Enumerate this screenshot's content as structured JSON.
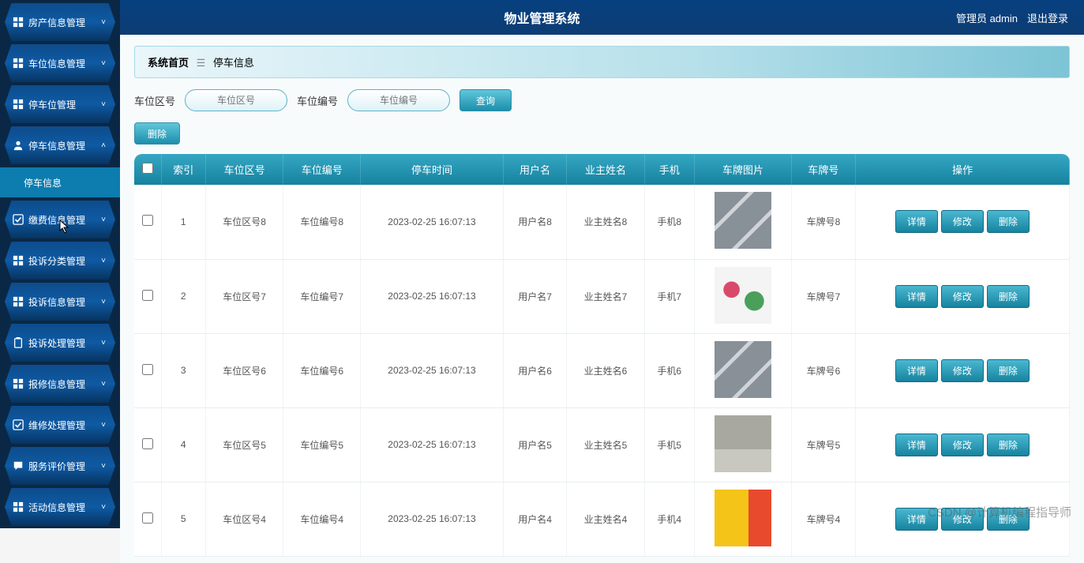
{
  "header": {
    "title": "物业管理系统",
    "admin_label": "管理员 admin",
    "logout": "退出登录"
  },
  "sidebar": {
    "items": [
      {
        "label": "房产信息管理",
        "icon": "grid-icon",
        "expanded": false
      },
      {
        "label": "车位信息管理",
        "icon": "grid-icon",
        "expanded": false
      },
      {
        "label": "停车位管理",
        "icon": "grid-icon",
        "expanded": false
      },
      {
        "label": "停车信息管理",
        "icon": "user-icon",
        "expanded": true,
        "children": [
          {
            "label": "停车信息",
            "active": true
          }
        ]
      },
      {
        "label": "缴费信息管理",
        "icon": "check-icon",
        "expanded": false,
        "hover": true
      },
      {
        "label": "投诉分类管理",
        "icon": "grid-icon",
        "expanded": false
      },
      {
        "label": "投诉信息管理",
        "icon": "grid-icon",
        "expanded": false
      },
      {
        "label": "投诉处理管理",
        "icon": "clipboard-icon",
        "expanded": false
      },
      {
        "label": "报修信息管理",
        "icon": "grid-icon",
        "expanded": false
      },
      {
        "label": "维修处理管理",
        "icon": "check-icon",
        "expanded": false
      },
      {
        "label": "服务评价管理",
        "icon": "chat-icon",
        "expanded": false
      },
      {
        "label": "活动信息管理",
        "icon": "grid-icon",
        "expanded": false
      }
    ]
  },
  "breadcrumb": {
    "home": "系统首页",
    "current": "停车信息"
  },
  "search": {
    "field1_label": "车位区号",
    "field1_placeholder": "车位区号",
    "field2_label": "车位编号",
    "field2_placeholder": "车位编号",
    "query_btn": "查询",
    "delete_btn": "删除"
  },
  "table": {
    "headers": [
      "",
      "索引",
      "车位区号",
      "车位编号",
      "停车时间",
      "用户名",
      "业主姓名",
      "手机",
      "车牌图片",
      "车牌号",
      "操作"
    ],
    "ops": {
      "detail": "详情",
      "edit": "修改",
      "delete": "删除"
    },
    "rows": [
      {
        "idx": "1",
        "zone": "车位区号8",
        "code": "车位编号8",
        "time": "2023-02-25 16:07:13",
        "user": "用户名8",
        "owner": "业主姓名8",
        "phone": "手机8",
        "plate": "车牌号8",
        "img": "img-parking"
      },
      {
        "idx": "2",
        "zone": "车位区号7",
        "code": "车位编号7",
        "time": "2023-02-25 16:07:13",
        "user": "用户名7",
        "owner": "业主姓名7",
        "phone": "手机7",
        "plate": "车牌号7",
        "img": "img-cartoon"
      },
      {
        "idx": "3",
        "zone": "车位区号6",
        "code": "车位编号6",
        "time": "2023-02-25 16:07:13",
        "user": "用户名6",
        "owner": "业主姓名6",
        "phone": "手机6",
        "plate": "车牌号6",
        "img": "img-parking"
      },
      {
        "idx": "4",
        "zone": "车位区号5",
        "code": "车位编号5",
        "time": "2023-02-25 16:07:13",
        "user": "用户名5",
        "owner": "业主姓名5",
        "phone": "手机5",
        "plate": "车牌号5",
        "img": "img-street"
      },
      {
        "idx": "5",
        "zone": "车位区号4",
        "code": "车位编号4",
        "time": "2023-02-25 16:07:13",
        "user": "用户名4",
        "owner": "业主姓名4",
        "phone": "手机4",
        "plate": "车牌号4",
        "img": "img-yellow"
      }
    ]
  },
  "watermark": "CSDN @计算机编程指导师"
}
